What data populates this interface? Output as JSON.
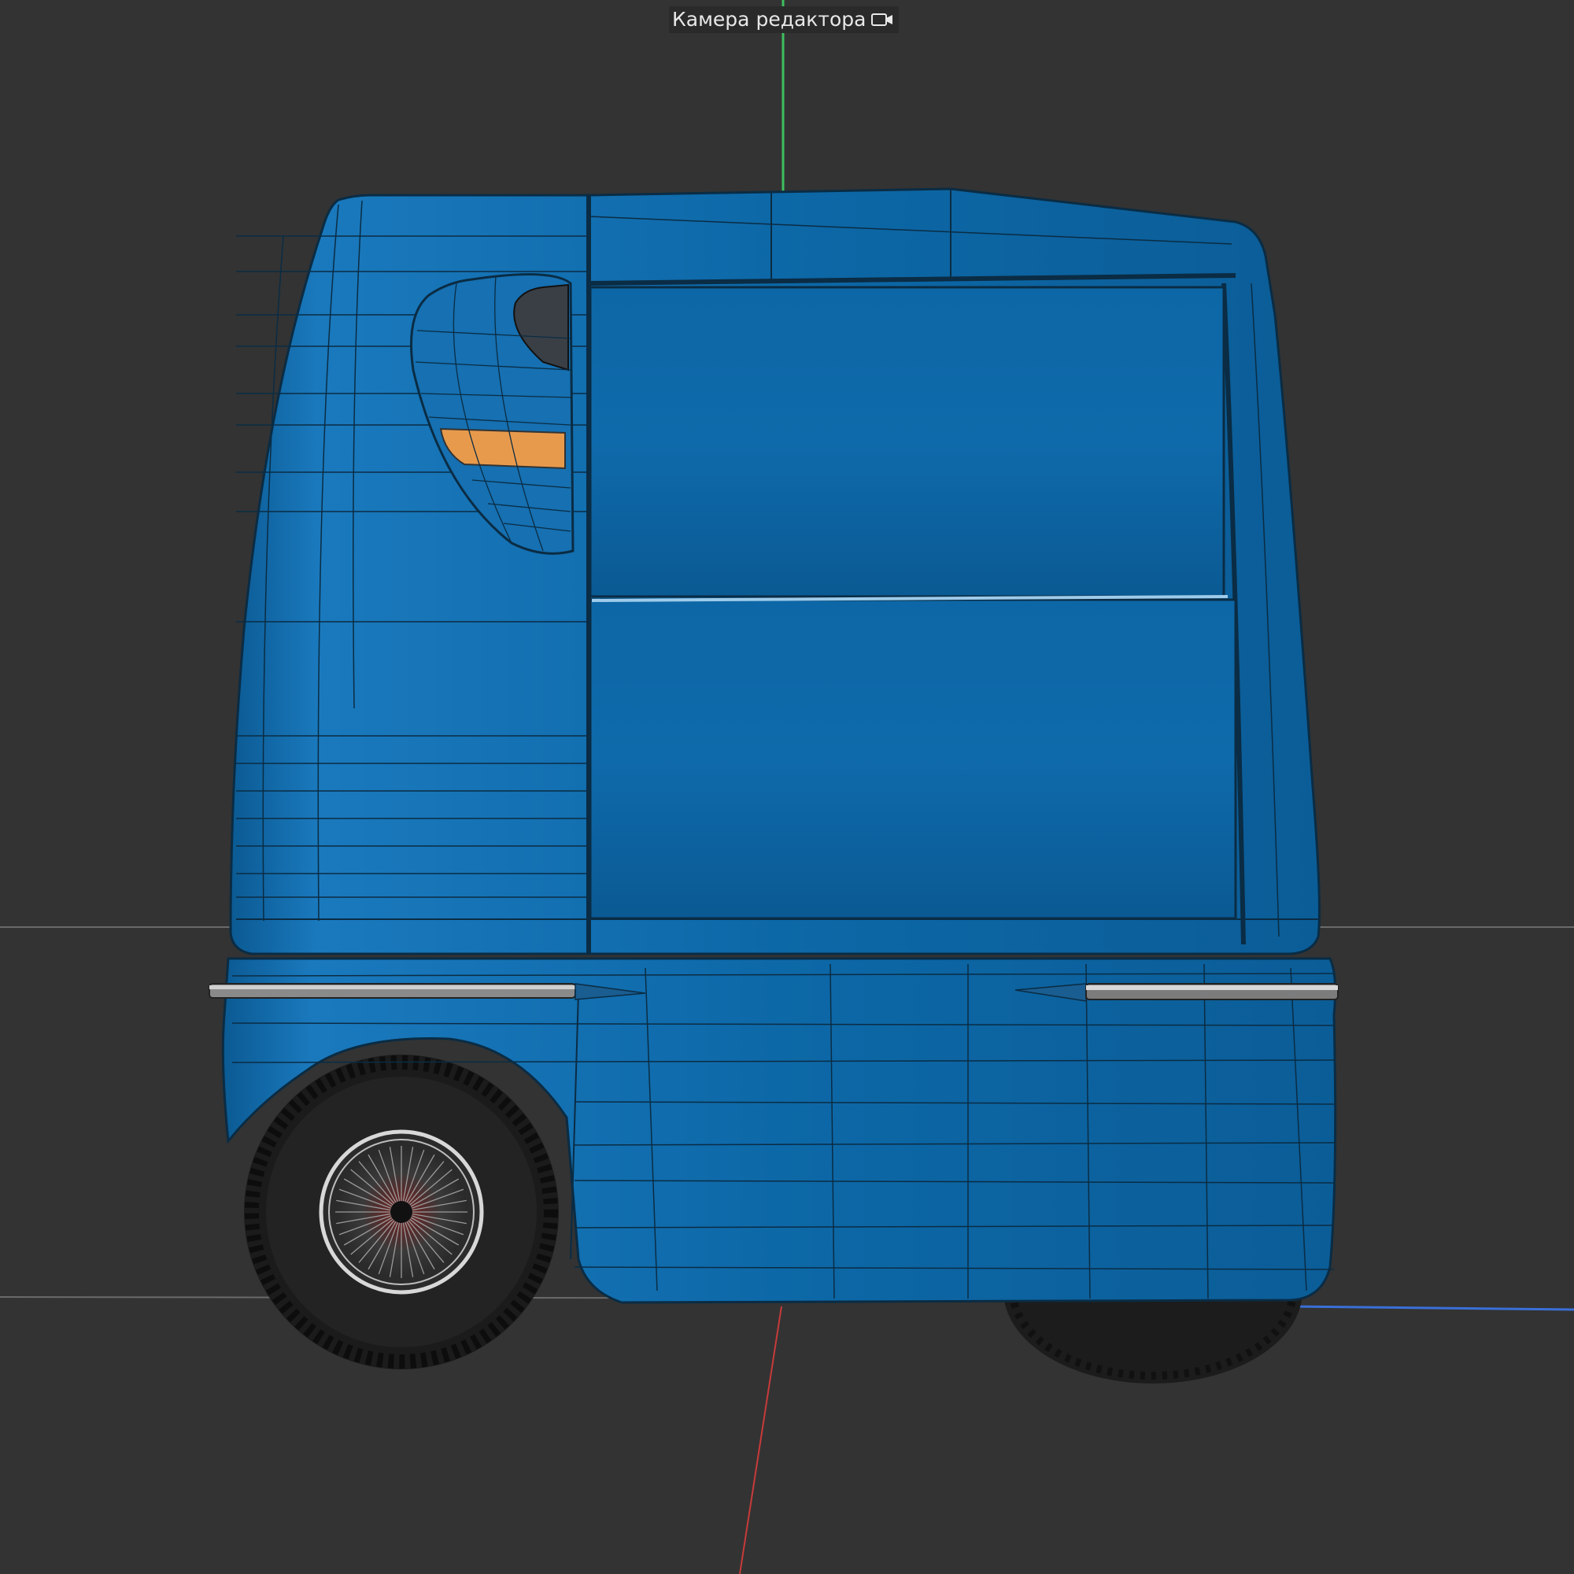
{
  "viewport": {
    "camera_label": "Камера редактора",
    "camera_icon": "camera-icon",
    "background_color": "#333333",
    "axis_colors": {
      "y": "#3fbf5f",
      "x": "#c83a3a",
      "z": "#3a6fd8"
    }
  },
  "model": {
    "body_color": "#0f69a8",
    "lamp_color": "#e89a4c"
  }
}
